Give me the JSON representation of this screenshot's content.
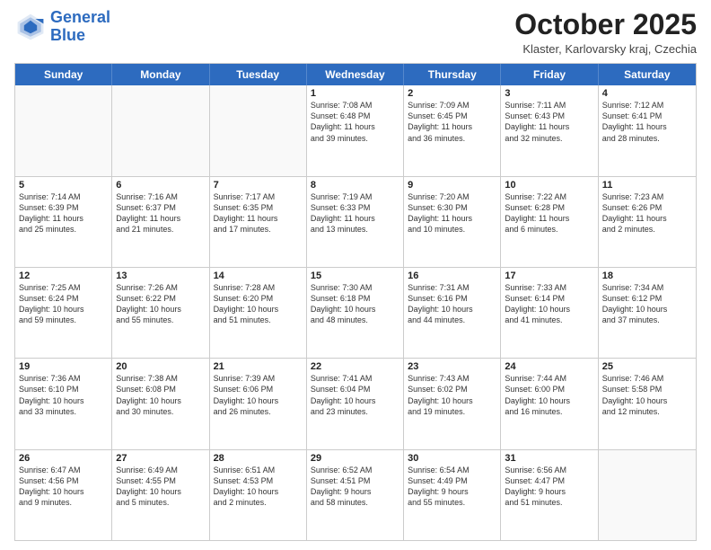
{
  "header": {
    "logo_general": "General",
    "logo_blue": "Blue",
    "month": "October 2025",
    "location": "Klaster, Karlovarsky kraj, Czechia"
  },
  "days_of_week": [
    "Sunday",
    "Monday",
    "Tuesday",
    "Wednesday",
    "Thursday",
    "Friday",
    "Saturday"
  ],
  "weeks": [
    [
      {
        "day": "",
        "empty": true
      },
      {
        "day": "",
        "empty": true
      },
      {
        "day": "",
        "empty": true
      },
      {
        "day": "1",
        "lines": [
          "Sunrise: 7:08 AM",
          "Sunset: 6:48 PM",
          "Daylight: 11 hours",
          "and 39 minutes."
        ]
      },
      {
        "day": "2",
        "lines": [
          "Sunrise: 7:09 AM",
          "Sunset: 6:45 PM",
          "Daylight: 11 hours",
          "and 36 minutes."
        ]
      },
      {
        "day": "3",
        "lines": [
          "Sunrise: 7:11 AM",
          "Sunset: 6:43 PM",
          "Daylight: 11 hours",
          "and 32 minutes."
        ]
      },
      {
        "day": "4",
        "lines": [
          "Sunrise: 7:12 AM",
          "Sunset: 6:41 PM",
          "Daylight: 11 hours",
          "and 28 minutes."
        ]
      }
    ],
    [
      {
        "day": "5",
        "lines": [
          "Sunrise: 7:14 AM",
          "Sunset: 6:39 PM",
          "Daylight: 11 hours",
          "and 25 minutes."
        ]
      },
      {
        "day": "6",
        "lines": [
          "Sunrise: 7:16 AM",
          "Sunset: 6:37 PM",
          "Daylight: 11 hours",
          "and 21 minutes."
        ]
      },
      {
        "day": "7",
        "lines": [
          "Sunrise: 7:17 AM",
          "Sunset: 6:35 PM",
          "Daylight: 11 hours",
          "and 17 minutes."
        ]
      },
      {
        "day": "8",
        "lines": [
          "Sunrise: 7:19 AM",
          "Sunset: 6:33 PM",
          "Daylight: 11 hours",
          "and 13 minutes."
        ]
      },
      {
        "day": "9",
        "lines": [
          "Sunrise: 7:20 AM",
          "Sunset: 6:30 PM",
          "Daylight: 11 hours",
          "and 10 minutes."
        ]
      },
      {
        "day": "10",
        "lines": [
          "Sunrise: 7:22 AM",
          "Sunset: 6:28 PM",
          "Daylight: 11 hours",
          "and 6 minutes."
        ]
      },
      {
        "day": "11",
        "lines": [
          "Sunrise: 7:23 AM",
          "Sunset: 6:26 PM",
          "Daylight: 11 hours",
          "and 2 minutes."
        ]
      }
    ],
    [
      {
        "day": "12",
        "lines": [
          "Sunrise: 7:25 AM",
          "Sunset: 6:24 PM",
          "Daylight: 10 hours",
          "and 59 minutes."
        ]
      },
      {
        "day": "13",
        "lines": [
          "Sunrise: 7:26 AM",
          "Sunset: 6:22 PM",
          "Daylight: 10 hours",
          "and 55 minutes."
        ]
      },
      {
        "day": "14",
        "lines": [
          "Sunrise: 7:28 AM",
          "Sunset: 6:20 PM",
          "Daylight: 10 hours",
          "and 51 minutes."
        ]
      },
      {
        "day": "15",
        "lines": [
          "Sunrise: 7:30 AM",
          "Sunset: 6:18 PM",
          "Daylight: 10 hours",
          "and 48 minutes."
        ]
      },
      {
        "day": "16",
        "lines": [
          "Sunrise: 7:31 AM",
          "Sunset: 6:16 PM",
          "Daylight: 10 hours",
          "and 44 minutes."
        ]
      },
      {
        "day": "17",
        "lines": [
          "Sunrise: 7:33 AM",
          "Sunset: 6:14 PM",
          "Daylight: 10 hours",
          "and 41 minutes."
        ]
      },
      {
        "day": "18",
        "lines": [
          "Sunrise: 7:34 AM",
          "Sunset: 6:12 PM",
          "Daylight: 10 hours",
          "and 37 minutes."
        ]
      }
    ],
    [
      {
        "day": "19",
        "lines": [
          "Sunrise: 7:36 AM",
          "Sunset: 6:10 PM",
          "Daylight: 10 hours",
          "and 33 minutes."
        ]
      },
      {
        "day": "20",
        "lines": [
          "Sunrise: 7:38 AM",
          "Sunset: 6:08 PM",
          "Daylight: 10 hours",
          "and 30 minutes."
        ]
      },
      {
        "day": "21",
        "lines": [
          "Sunrise: 7:39 AM",
          "Sunset: 6:06 PM",
          "Daylight: 10 hours",
          "and 26 minutes."
        ]
      },
      {
        "day": "22",
        "lines": [
          "Sunrise: 7:41 AM",
          "Sunset: 6:04 PM",
          "Daylight: 10 hours",
          "and 23 minutes."
        ]
      },
      {
        "day": "23",
        "lines": [
          "Sunrise: 7:43 AM",
          "Sunset: 6:02 PM",
          "Daylight: 10 hours",
          "and 19 minutes."
        ]
      },
      {
        "day": "24",
        "lines": [
          "Sunrise: 7:44 AM",
          "Sunset: 6:00 PM",
          "Daylight: 10 hours",
          "and 16 minutes."
        ]
      },
      {
        "day": "25",
        "lines": [
          "Sunrise: 7:46 AM",
          "Sunset: 5:58 PM",
          "Daylight: 10 hours",
          "and 12 minutes."
        ]
      }
    ],
    [
      {
        "day": "26",
        "lines": [
          "Sunrise: 6:47 AM",
          "Sunset: 4:56 PM",
          "Daylight: 10 hours",
          "and 9 minutes."
        ]
      },
      {
        "day": "27",
        "lines": [
          "Sunrise: 6:49 AM",
          "Sunset: 4:55 PM",
          "Daylight: 10 hours",
          "and 5 minutes."
        ]
      },
      {
        "day": "28",
        "lines": [
          "Sunrise: 6:51 AM",
          "Sunset: 4:53 PM",
          "Daylight: 10 hours",
          "and 2 minutes."
        ]
      },
      {
        "day": "29",
        "lines": [
          "Sunrise: 6:52 AM",
          "Sunset: 4:51 PM",
          "Daylight: 9 hours",
          "and 58 minutes."
        ]
      },
      {
        "day": "30",
        "lines": [
          "Sunrise: 6:54 AM",
          "Sunset: 4:49 PM",
          "Daylight: 9 hours",
          "and 55 minutes."
        ]
      },
      {
        "day": "31",
        "lines": [
          "Sunrise: 6:56 AM",
          "Sunset: 4:47 PM",
          "Daylight: 9 hours",
          "and 51 minutes."
        ]
      },
      {
        "day": "",
        "empty": true
      }
    ]
  ]
}
